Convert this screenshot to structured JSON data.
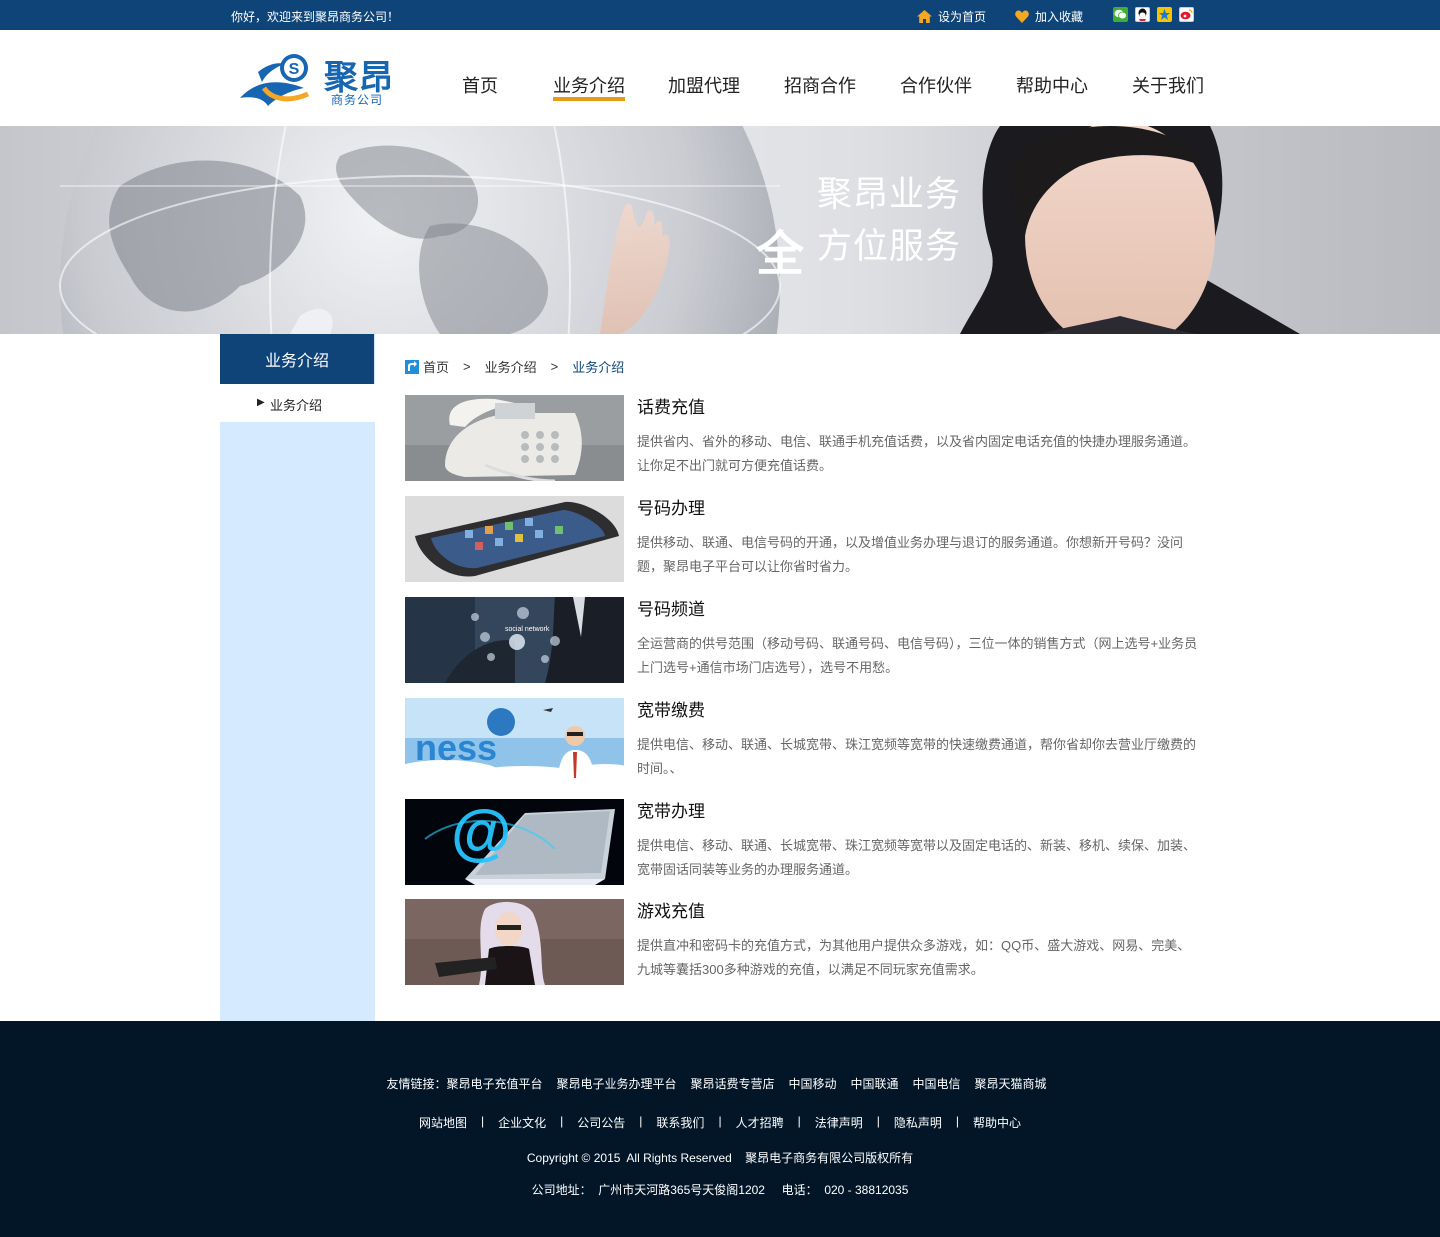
{
  "topbar": {
    "welcome": "你好，欢迎来到聚昂商务公司！",
    "set_home": "设为首页",
    "favorite": "加入收藏",
    "socials": [
      "wechat-icon",
      "qq-icon",
      "qzone-icon",
      "weibo-icon"
    ]
  },
  "logo": {
    "name": "聚昂",
    "sub": "商务公司"
  },
  "nav": {
    "items": [
      "首页",
      "业务介绍",
      "加盟代理",
      "招商合作",
      "合作伙伴",
      "帮助中心",
      "关于我们"
    ],
    "active_index": 1
  },
  "banner": {
    "line1": "聚昂业务",
    "big": "全",
    "line2": "方位服务"
  },
  "sidebar": {
    "title": "业务介绍",
    "item": "业务介绍"
  },
  "breadcrumb": {
    "home": "首页",
    "sep1": ">",
    "level2": "业务介绍",
    "sep2": ">",
    "current": "业务介绍"
  },
  "services": [
    {
      "title": "话费充值",
      "desc": "提供省内、省外的移动、电信、联通手机充值话费，以及省内固定电话充值的快捷办理服务通道。让你足不出门就可方便充值话费。"
    },
    {
      "title": "号码办理",
      "desc": "提供移动、联通、电信号码的开通，以及增值业务办理与退订的服务通道。你想新开号码？没问题，聚昂电子平台可以让你省时省力。"
    },
    {
      "title": "号码频道",
      "desc": "全运营商的供号范围（移动号码、联通号码、电信号码），三位一体的销售方式（网上选号+业务员上门选号+通信市场门店选号），选号不用愁。"
    },
    {
      "title": "宽带缴费",
      "desc": "提供电信、移动、联通、长城宽带、珠江宽频等宽带的快速缴费通道，帮你省却你去营业厅缴费的时间。、"
    },
    {
      "title": "宽带办理",
      "desc": "提供电信、移动、联通、长城宽带、珠江宽频等宽带以及固定电话的、新装、移机、续保、加装、宽带固话同装等业务的办理服务通道。"
    },
    {
      "title": "游戏充值",
      "desc": "提供直冲和密码卡的充值方式，为其他用户提供众多游戏，如：QQ币、盛大游戏、网易、完美、九城等囊括300多种游戏的充值，以满足不同玩家充值需求。"
    }
  ],
  "footer": {
    "friend_label": "友情链接：",
    "friend_links": [
      "聚昂电子充值平台",
      "聚昂电子业务办理平台",
      "聚昂话费专营店",
      "中国移动",
      "中国联通",
      "中国电信",
      "聚昂天猫商城"
    ],
    "nav_links": [
      "网站地图",
      "企业文化",
      "公司公告",
      "联系我们",
      "人才招聘",
      "法律声明",
      "隐私声明",
      "帮助中心"
    ],
    "separator": "|",
    "copyright": "Copyright © 2015  All Rights Reserved    聚昂电子商务有限公司版权所有",
    "address": "公司地址：  广州市天河路365号天俊阁1202     电话：  020 - 38812035"
  }
}
